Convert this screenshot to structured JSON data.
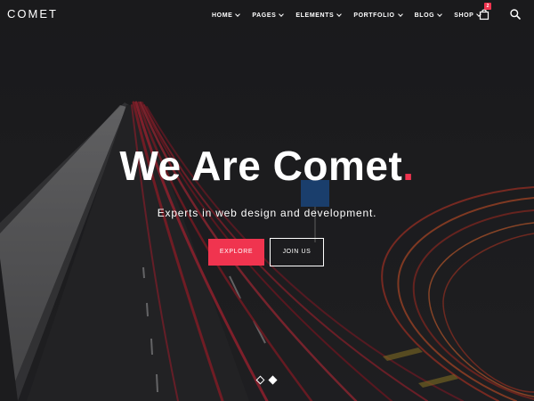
{
  "brand": {
    "logo_text": "COMET",
    "accent_color": "#f0344f"
  },
  "nav": {
    "items": [
      {
        "label": "HOME"
      },
      {
        "label": "PAGES"
      },
      {
        "label": "ELEMENTS"
      },
      {
        "label": "PORTFOLIO"
      },
      {
        "label": "BLOG"
      },
      {
        "label": "SHOP"
      }
    ],
    "cart_icon": "shopping-bag-icon",
    "cart_count": "2",
    "search_icon": "search-icon"
  },
  "hero": {
    "title": "We Are Comet",
    "title_dot": ".",
    "subtitle": "Experts in web design and development.",
    "primary_button": "EXPLORE",
    "secondary_button": "JOIN US"
  },
  "slider": {
    "dots": 2,
    "active_index": 1
  }
}
